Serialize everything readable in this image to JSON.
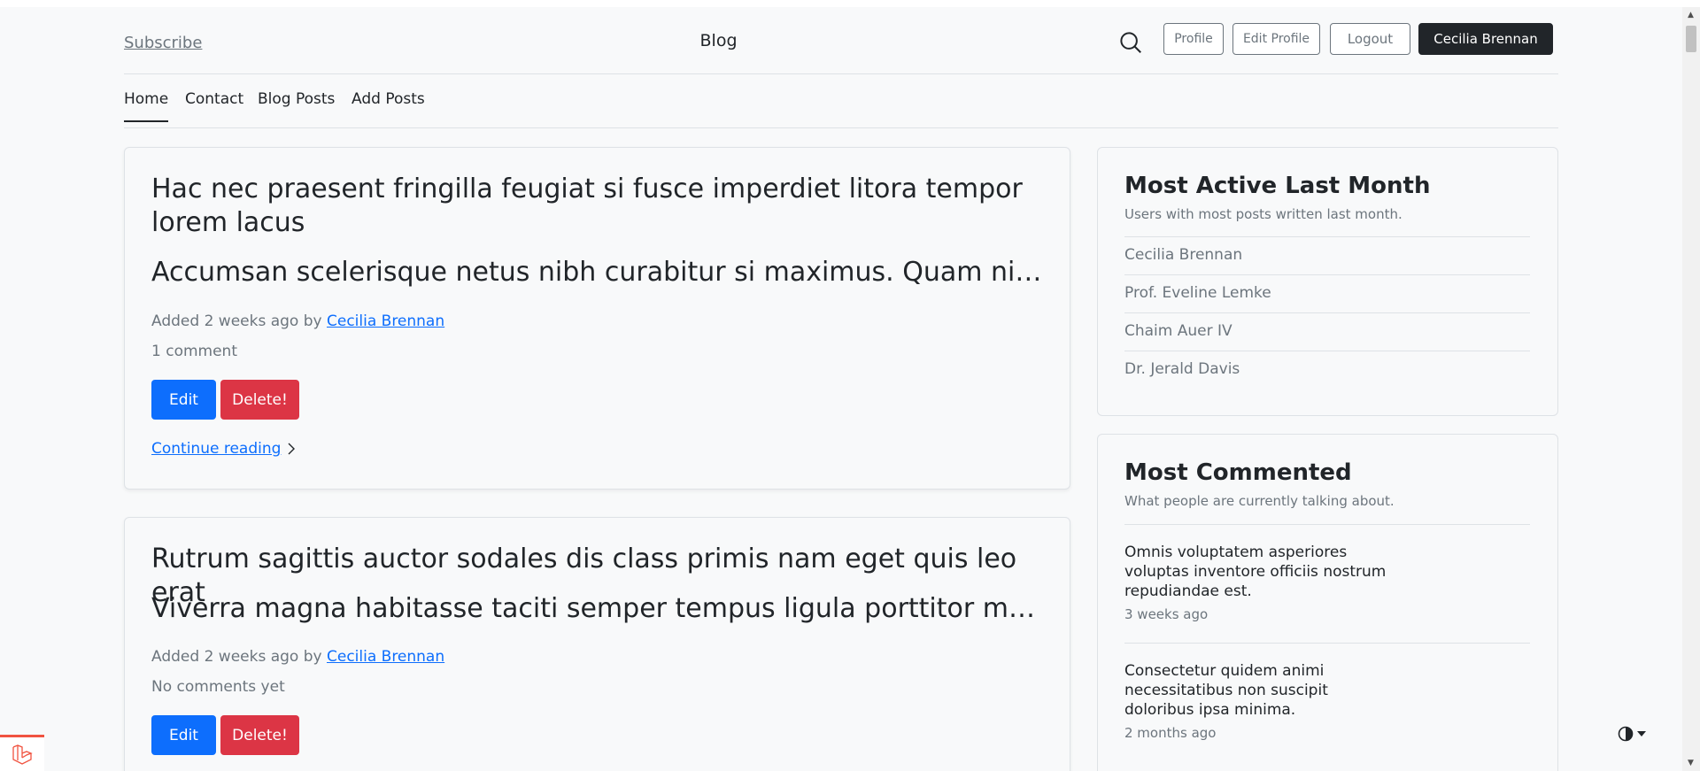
{
  "header": {
    "subscribe_label": "Subscribe",
    "brand": "Blog",
    "profile_label": "Profile",
    "edit_profile_label": "Edit Profile",
    "logout_label": "Logout",
    "user_label": "Cecilia Brennan"
  },
  "nav": {
    "items": [
      {
        "label": "Home",
        "active": true
      },
      {
        "label": "Contact"
      },
      {
        "label": "Blog Posts"
      },
      {
        "label": "Add Posts"
      }
    ]
  },
  "posts": [
    {
      "title": "Hac nec praesent fringilla feugiat si fusce imperdiet litora tempor lorem lacus",
      "excerpt": "Accumsan scelerisque netus nibh curabitur si maximus. Quam nibh dapibus",
      "added": "Added 2 weeks ago by",
      "author": "Cecilia Brennan",
      "comments": "1 comment",
      "edit_label": "Edit",
      "delete_label": "Delete!",
      "continue_label": "Continue reading"
    },
    {
      "title": "Rutrum sagittis auctor sodales dis class primis nam eget quis leo erat",
      "excerpt": "Viverra magna habitasse taciti semper tempus ligula porttitor massa sem",
      "added": "Added 2 weeks ago by",
      "author": "Cecilia Brennan",
      "comments": "No comments yet",
      "edit_label": "Edit",
      "delete_label": "Delete!"
    }
  ],
  "sidebar": {
    "most_active": {
      "title": "Most Active Last Month",
      "subtitle": "Users with most posts written last month.",
      "users": [
        "Cecilia Brennan",
        "Prof. Eveline Lemke",
        "Chaim Auer IV",
        "Dr. Jerald Davis"
      ]
    },
    "most_commented": {
      "title": "Most Commented",
      "subtitle": "What people are currently talking about.",
      "items": [
        {
          "title": "Omnis voluptatem asperiores voluptas inventore officiis nostrum repudiandae est.",
          "time": "3 weeks ago"
        },
        {
          "title": "Consectetur quidem animi necessitatibus non suscipit doloribus ipsa minima.",
          "time": "2 months ago"
        }
      ]
    }
  },
  "icons": {
    "search": "search-icon",
    "chevron": "chevron-right-icon",
    "theme": "contrast-icon",
    "laravel": "laravel-logo-icon"
  },
  "colors": {
    "primary": "#0d6efd",
    "danger": "#dc3545",
    "dark": "#212529",
    "muted": "#6c757d",
    "laravel": "#f05340"
  }
}
